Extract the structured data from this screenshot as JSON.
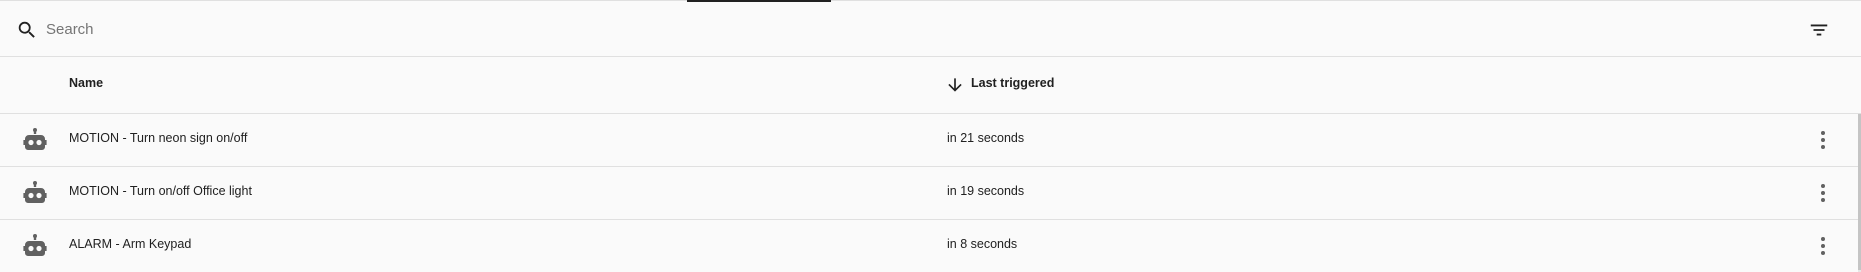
{
  "search": {
    "placeholder": "Search",
    "value": ""
  },
  "table": {
    "columns": {
      "name": "Name",
      "last_triggered": "Last triggered"
    },
    "sort_icon": "arrow-down-icon",
    "rows": [
      {
        "icon": "robot-icon",
        "name": "MOTION - Turn neon sign on/off",
        "last_triggered": "in 21 seconds"
      },
      {
        "icon": "robot-icon",
        "name": "MOTION - Turn on/off Office light",
        "last_triggered": "in 19 seconds"
      },
      {
        "icon": "robot-icon",
        "name": "ALARM - Arm Keypad",
        "last_triggered": "in 8 seconds"
      }
    ]
  },
  "icons": {
    "search": "search-icon",
    "filter": "filter-icon",
    "overflow": "more-vertical-icon"
  },
  "colors": {
    "background": "#fafafa",
    "divider": "#e0e0e0",
    "icon": "#616161",
    "text": "#212121"
  }
}
